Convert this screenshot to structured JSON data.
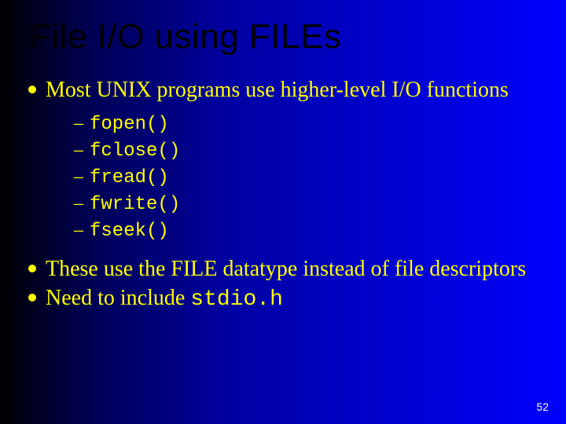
{
  "title": "File I/O using FILEs",
  "bullets": [
    {
      "text": "Most UNIX programs use higher-level I/O functions",
      "sub": [
        "fopen()",
        "fclose()",
        "fread()",
        "fwrite()",
        "fseek()"
      ]
    },
    {
      "text": "These use the FILE datatype instead of file descriptors"
    },
    {
      "text_prefix": "Need to include ",
      "code": "stdio.h"
    }
  ],
  "page_number": "52"
}
